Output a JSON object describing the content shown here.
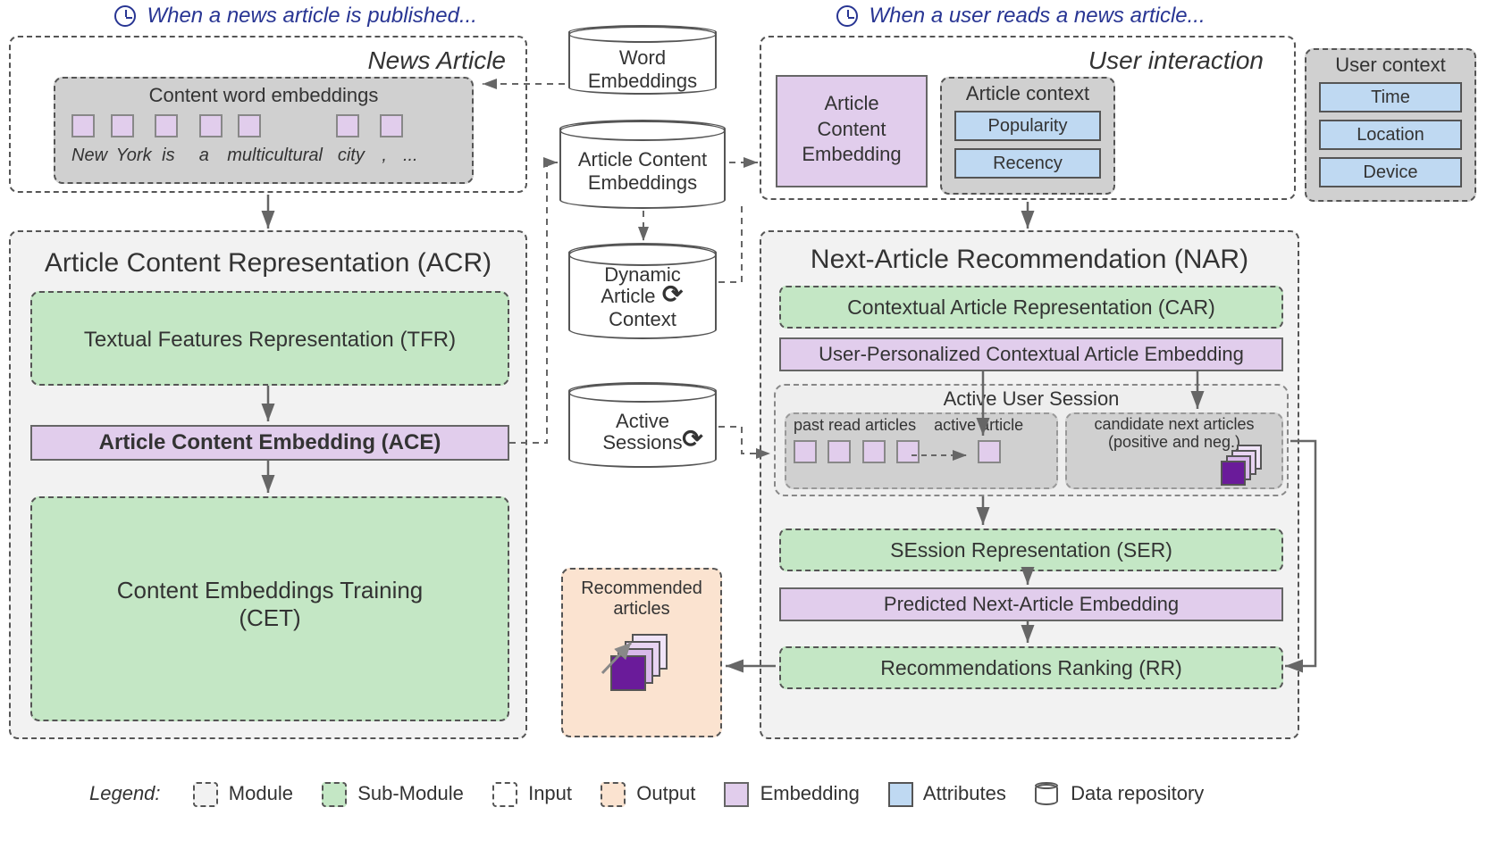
{
  "triggers": {
    "publish": "When a news article is published...",
    "read": "When a user reads a news article..."
  },
  "news_article": {
    "title": "News Article",
    "embeds_title": "Content word embeddings",
    "tokens": [
      "New",
      "York",
      "is",
      "a",
      "multicultural",
      "city",
      ",",
      "..."
    ]
  },
  "acr": {
    "title": "Article Content Representation (ACR)",
    "tfr": "Textual Features Representation (TFR)",
    "ace": "Article Content Embedding (ACE)",
    "cet_l1": "Content Embeddings Training",
    "cet_l2": "(CET)"
  },
  "repos": {
    "word": "Word Embeddings",
    "ace": "Article Content Embeddings",
    "dac_l1": "Dynamic",
    "dac_l2": "Article",
    "dac_l3": "Context",
    "active_l1": "Active",
    "active_l2": "Sessions"
  },
  "user_interaction": {
    "title": "User interaction",
    "ace_box_l1": "Article",
    "ace_box_l2": "Content",
    "ace_box_l3": "Embedding",
    "article_ctx": "Article context",
    "popularity": "Popularity",
    "recency": "Recency",
    "user_ctx": "User context",
    "time": "Time",
    "location": "Location",
    "device": "Device"
  },
  "nar": {
    "title": "Next-Article Recommendation (NAR)",
    "car": "Contextual Article Representation (CAR)",
    "upcae": "User-Personalized Contextual Article Embedding",
    "aus_title": "Active User Session",
    "past_label": "past read articles",
    "active_label": "active article",
    "cand_l1": "candidate next articles",
    "cand_l2": "(positive and neg.)",
    "ser": "SEssion Representation (SER)",
    "pnae": "Predicted Next-Article Embedding",
    "rr": "Recommendations Ranking (RR)"
  },
  "output": {
    "l1": "Recommended",
    "l2": "articles"
  },
  "legend": {
    "title": "Legend:",
    "module": "Module",
    "submodule": "Sub-Module",
    "input": "Input",
    "output": "Output",
    "embedding": "Embedding",
    "attributes": "Attributes",
    "repo": "Data repository"
  }
}
